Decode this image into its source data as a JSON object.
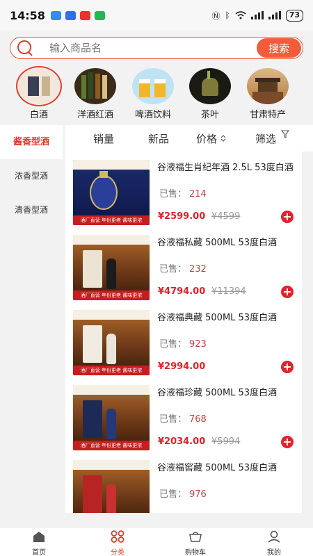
{
  "status": {
    "time": "14:58",
    "battery": "73"
  },
  "search": {
    "placeholder": "输入商品名",
    "button": "搜索"
  },
  "categories": [
    {
      "label": "白酒"
    },
    {
      "label": "洋酒红酒"
    },
    {
      "label": "啤酒饮料"
    },
    {
      "label": "茶叶"
    },
    {
      "label": "甘肃特产"
    }
  ],
  "side_menu": [
    {
      "label": "酱香型酒"
    },
    {
      "label": "浓香型酒"
    },
    {
      "label": "清香型酒"
    }
  ],
  "sort": {
    "sales": "销量",
    "new": "新品",
    "price": "价格",
    "filter": "筛选"
  },
  "sold_label": "已售：",
  "products": [
    {
      "title": "谷液福生肖纪年酒 2.5L 53度白酒",
      "sold": "214",
      "price": "¥2599.00",
      "original": "¥4599"
    },
    {
      "title": "谷液福私藏 500ML 53度白酒",
      "sold": "232",
      "price": "¥4794.00",
      "original": "¥11394"
    },
    {
      "title": "谷液福典藏 500ML 53度白酒",
      "sold": "923",
      "price": "¥2994.00",
      "original": ""
    },
    {
      "title": "谷液福珍藏 500ML 53度白酒",
      "sold": "768",
      "price": "¥2034.00",
      "original": "¥5994"
    },
    {
      "title": "谷液福窖藏 500ML 53度白酒",
      "sold": "976",
      "price": "",
      "original": ""
    }
  ],
  "thumb": {
    "banner": "酒厂直营 年份更老 酱味更浓"
  },
  "tabs": [
    {
      "label": "首页"
    },
    {
      "label": "分类"
    },
    {
      "label": "购物车"
    },
    {
      "label": "我的"
    }
  ],
  "colors": {
    "accent": "#e53b2c",
    "price": "#e0232a",
    "search_button": "#f35c3b"
  }
}
